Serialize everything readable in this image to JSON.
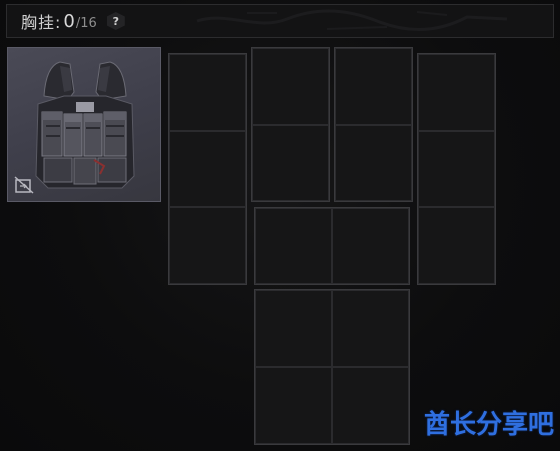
{
  "header": {
    "title": "胸挂:",
    "count": "0",
    "capacity": "/16",
    "help_label": "?"
  },
  "item": {
    "name": "chest-rig",
    "icon": "unequip-icon"
  },
  "grids": [
    {
      "id": "grid-1",
      "cols": 1,
      "rows": 3
    },
    {
      "id": "grid-2",
      "cols": 1,
      "rows": 2
    },
    {
      "id": "grid-3",
      "cols": 1,
      "rows": 2
    },
    {
      "id": "grid-4",
      "cols": 1,
      "rows": 3
    },
    {
      "id": "grid-5",
      "cols": 2,
      "rows": 1
    },
    {
      "id": "grid-6",
      "cols": 2,
      "rows": 2
    }
  ],
  "watermark": "酋长分享吧",
  "colors": {
    "background": "#0c0c0d",
    "card": "#3f3f4b",
    "watermark": "#2f6fe0"
  }
}
